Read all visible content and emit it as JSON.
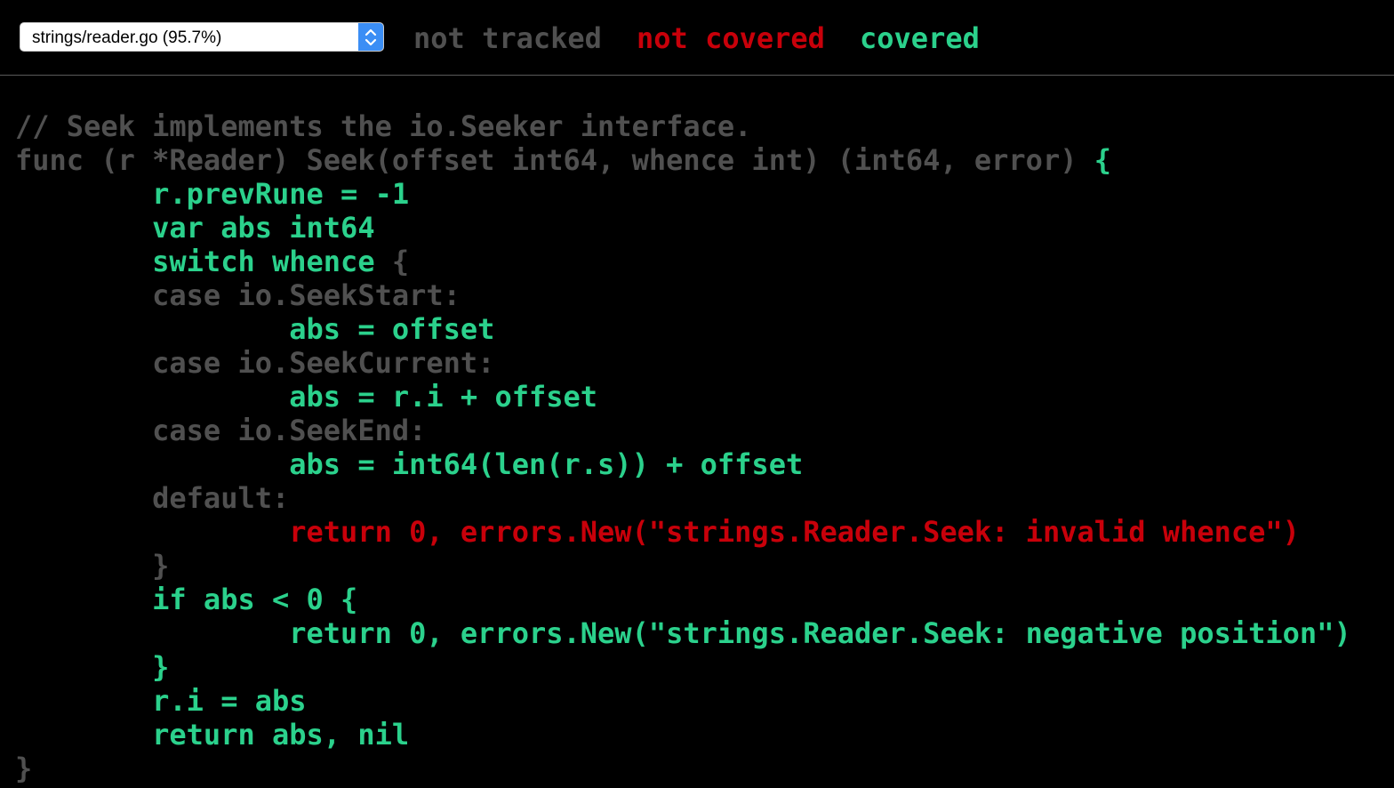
{
  "header": {
    "file_select": {
      "selected": "strings/reader.go (95.7%)"
    },
    "legend": {
      "not_tracked": "not tracked",
      "not_covered": "not covered",
      "covered": "covered"
    }
  },
  "colors": {
    "not_tracked": "#505050",
    "not_covered": "#c8000a",
    "covered": "#2bd18c",
    "background": "#000000",
    "select_accent": "#3b8ef5"
  },
  "icons": {
    "select_arrows": "chevron-up-down-icon"
  },
  "code": {
    "lines": [
      {
        "segments": [
          {
            "status": "nt",
            "text": "// Seek implements the io.Seeker interface."
          }
        ]
      },
      {
        "segments": [
          {
            "status": "nt",
            "text": "func (r *Reader) Seek(offset int64, whence int) (int64, error) "
          },
          {
            "status": "cv",
            "text": "{"
          }
        ]
      },
      {
        "segments": [
          {
            "status": "cv",
            "text": "        r.prevRune = -1"
          }
        ]
      },
      {
        "segments": [
          {
            "status": "cv",
            "text": "        var abs int64"
          }
        ]
      },
      {
        "segments": [
          {
            "status": "cv",
            "text": "        switch whence "
          },
          {
            "status": "nt",
            "text": "{"
          }
        ]
      },
      {
        "segments": [
          {
            "status": "nt",
            "text": "        case io.SeekStart:"
          }
        ]
      },
      {
        "segments": [
          {
            "status": "cv",
            "text": "                abs = offset"
          }
        ]
      },
      {
        "segments": [
          {
            "status": "nt",
            "text": "        case io.SeekCurrent:"
          }
        ]
      },
      {
        "segments": [
          {
            "status": "cv",
            "text": "                abs = r.i + offset"
          }
        ]
      },
      {
        "segments": [
          {
            "status": "nt",
            "text": "        case io.SeekEnd:"
          }
        ]
      },
      {
        "segments": [
          {
            "status": "cv",
            "text": "                abs = int64(len(r.s)) + offset"
          }
        ]
      },
      {
        "segments": [
          {
            "status": "nt",
            "text": "        default:"
          }
        ]
      },
      {
        "segments": [
          {
            "status": "nc",
            "text": "                return 0, errors.New(\"strings.Reader.Seek: invalid whence\")"
          }
        ]
      },
      {
        "segments": [
          {
            "status": "nt",
            "text": "        }"
          }
        ]
      },
      {
        "segments": [
          {
            "status": "cv",
            "text": "        if abs < 0 {"
          }
        ]
      },
      {
        "segments": [
          {
            "status": "cv",
            "text": "                return 0, errors.New(\"strings.Reader.Seek: negative position\")"
          }
        ]
      },
      {
        "segments": [
          {
            "status": "cv",
            "text": "        }"
          }
        ]
      },
      {
        "segments": [
          {
            "status": "cv",
            "text": "        r.i = abs"
          }
        ]
      },
      {
        "segments": [
          {
            "status": "cv",
            "text": "        return abs, nil"
          }
        ]
      },
      {
        "segments": [
          {
            "status": "nt",
            "text": "}"
          }
        ]
      }
    ]
  }
}
